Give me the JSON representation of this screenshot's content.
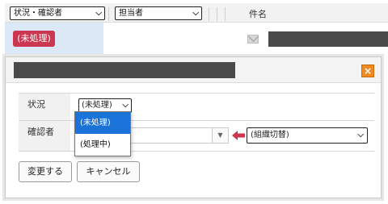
{
  "list_header": {
    "status_filter": "状況・確認者",
    "assignee_filter": "担当者",
    "column_title": "件名"
  },
  "list_row": {
    "status_badge": "(未処理)",
    "badge_color": "#cc3650"
  },
  "dialog": {
    "close_label": "×",
    "fields": {
      "status_label": "状況",
      "status_value": "(未処理)",
      "confirmer_label": "確認者",
      "confirmer_value": "",
      "org_select_value": "(組織切替)"
    },
    "dropdown_options": [
      "(未処理)",
      "(処理中)"
    ],
    "buttons": {
      "change": "変更する",
      "cancel": "キャンセル"
    }
  },
  "colors": {
    "accent_selected": "#1a73d9",
    "close_button": "#ee8a1f",
    "arrow": "#cc3650"
  }
}
